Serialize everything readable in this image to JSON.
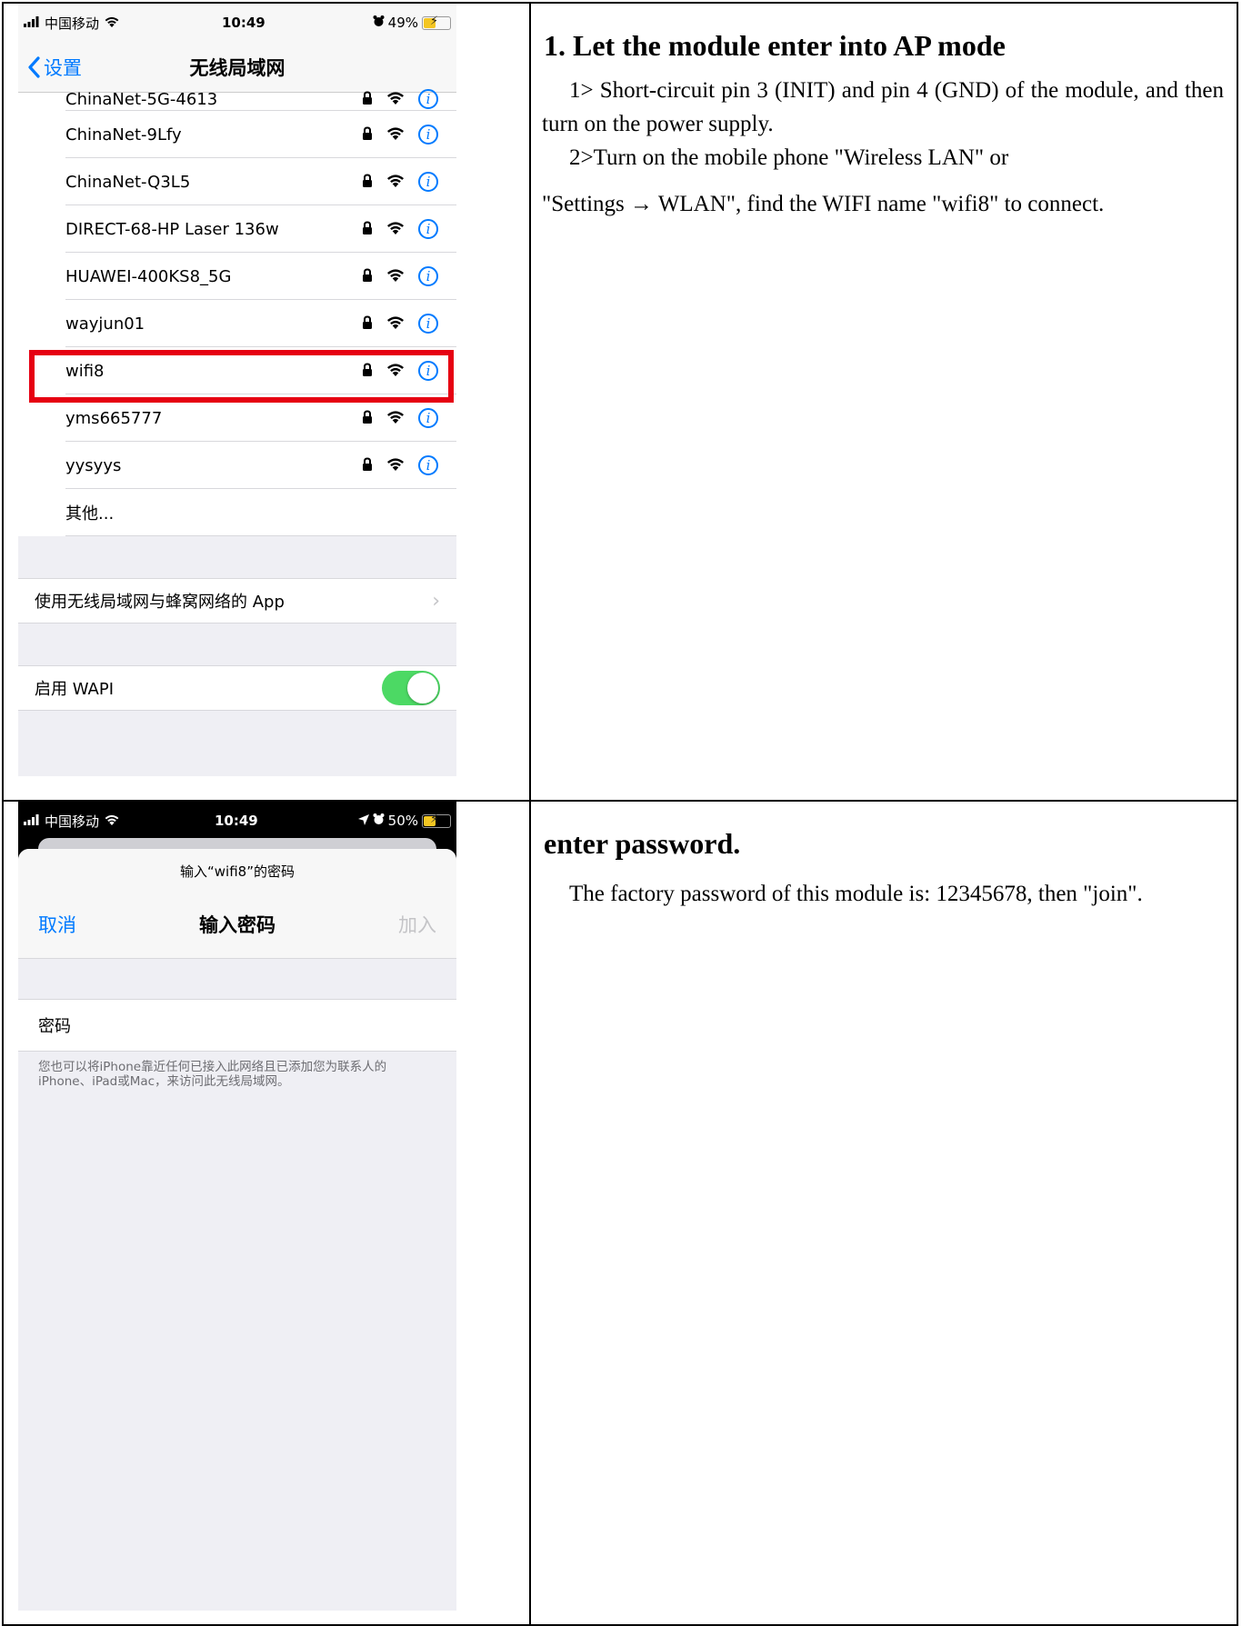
{
  "row1": {
    "phone": {
      "status": {
        "carrier": "中国移动",
        "time": "10:49",
        "battery": "49%",
        "battery_level": 0.49
      },
      "nav": {
        "back_label": "设置",
        "title": "无线局域网"
      },
      "networks": [
        {
          "name": "ChinaNet-5G-4613"
        },
        {
          "name": "ChinaNet-9Lfy"
        },
        {
          "name": "ChinaNet-Q3L5"
        },
        {
          "name": "DIRECT-68-HP Laser 136w"
        },
        {
          "name": "HUAWEI-400KS8_5G"
        },
        {
          "name": "wayjun01"
        },
        {
          "name": "wifi8"
        },
        {
          "name": "yms665777"
        },
        {
          "name": "yysyys"
        }
      ],
      "other_label": "其他...",
      "apps_label": "使用无线局域网与蜂窝网络的 App",
      "wapi_label": "启用 WAPI",
      "wapi_enabled": true,
      "info_glyph": "i",
      "highlight_color": "#e60012",
      "accent_color": "#007aff"
    },
    "heading": "1. Let the module enter into AP mode",
    "step1": "1> Short-circuit pin 3 (INIT) and pin 4 (GND) of the module, and then turn on the power supply.",
    "step2": "2>Turn on the mobile phone \"Wireless LAN\" or",
    "step2_cont": "\"Settings → WLAN\", find the WIFI name \"wifi8\" to connect."
  },
  "row2": {
    "phone": {
      "status": {
        "carrier": "中国移动",
        "time": "10:49",
        "battery": "50%",
        "battery_level": 0.5
      },
      "prompt": "输入“wifi8”的密码",
      "cancel_label": "取消",
      "title": "输入密码",
      "join_label": "加入",
      "password_label": "密码",
      "note": "您也可以将iPhone靠近任何已接入此网络且已添加您为联系人的iPhone、iPad或Mac，来访问此无线局域网。"
    },
    "heading": "enter password.",
    "body": "The factory password of this module is: 12345678, then \"join\"."
  }
}
